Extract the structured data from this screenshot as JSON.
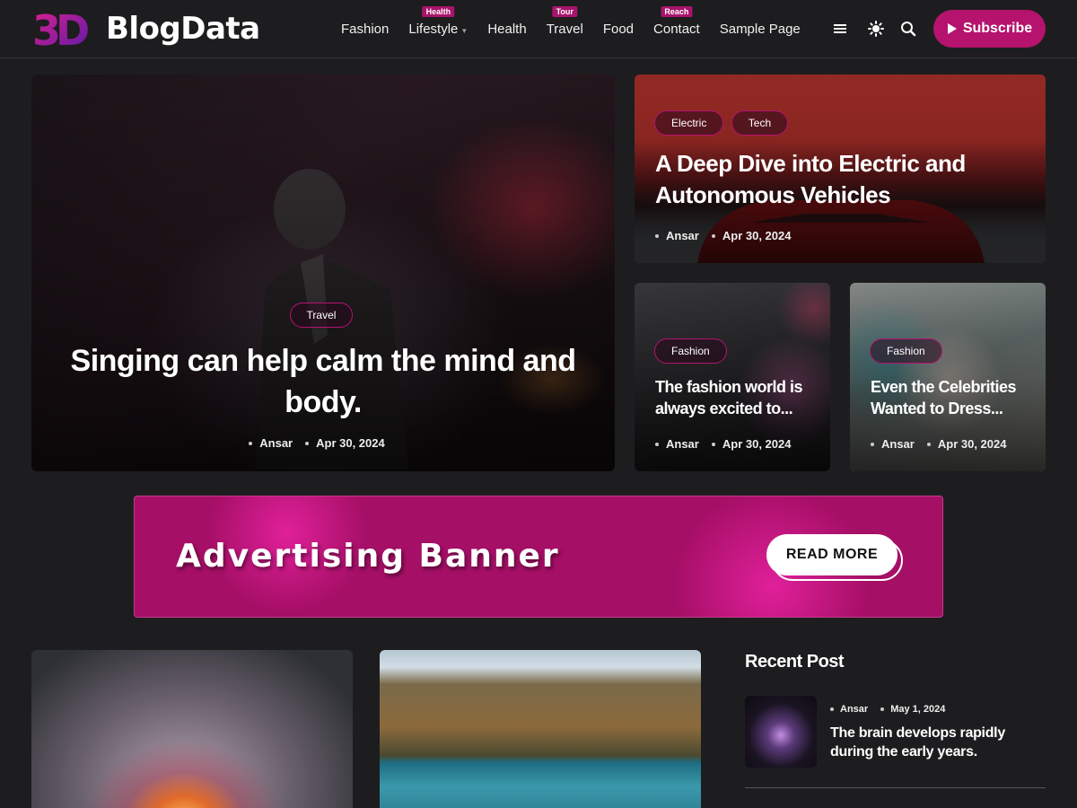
{
  "brand": {
    "logo_mark": "3D",
    "name": "BlogData",
    "accent": "#b5136e"
  },
  "nav": {
    "items": [
      {
        "label": "Fashion",
        "badge": ""
      },
      {
        "label": "Lifestyle",
        "badge": "Health",
        "has_dropdown": true
      },
      {
        "label": "Health",
        "badge": ""
      },
      {
        "label": "Travel",
        "badge": "Tour"
      },
      {
        "label": "Food",
        "badge": ""
      },
      {
        "label": "Contact",
        "badge": "Reach"
      },
      {
        "label": "Sample Page",
        "badge": ""
      }
    ],
    "icons": [
      "hamburger-menu-icon",
      "theme-toggle-icon",
      "search-icon"
    ],
    "subscribe_label": "Subscribe"
  },
  "featured": {
    "main": {
      "tags": [
        "Travel"
      ],
      "title": "Singing can help calm the mind and body.",
      "author": "Ansar",
      "date": "Apr 30, 2024"
    },
    "top_right": {
      "tags": [
        "Electric",
        "Tech"
      ],
      "title": "A Deep Dive into Electric and Autonomous Vehicles",
      "author": "Ansar",
      "date": "Apr 30, 2024"
    },
    "bottom_left": {
      "tags": [
        "Fashion"
      ],
      "title": "The fashion world is always excited to...",
      "author": "Ansar",
      "date": "Apr 30, 2024"
    },
    "bottom_right": {
      "tags": [
        "Fashion"
      ],
      "title": "Even the Celebrities Wanted to Dress...",
      "author": "Ansar",
      "date": "Apr 30, 2024"
    }
  },
  "ad": {
    "text": "Advertising Banner",
    "button": "READ MORE"
  },
  "sidebar": {
    "heading": "Recent Post",
    "posts": [
      {
        "author": "Ansar",
        "date": "May 1, 2024",
        "title": "The brain develops rapidly during the early years."
      }
    ]
  }
}
